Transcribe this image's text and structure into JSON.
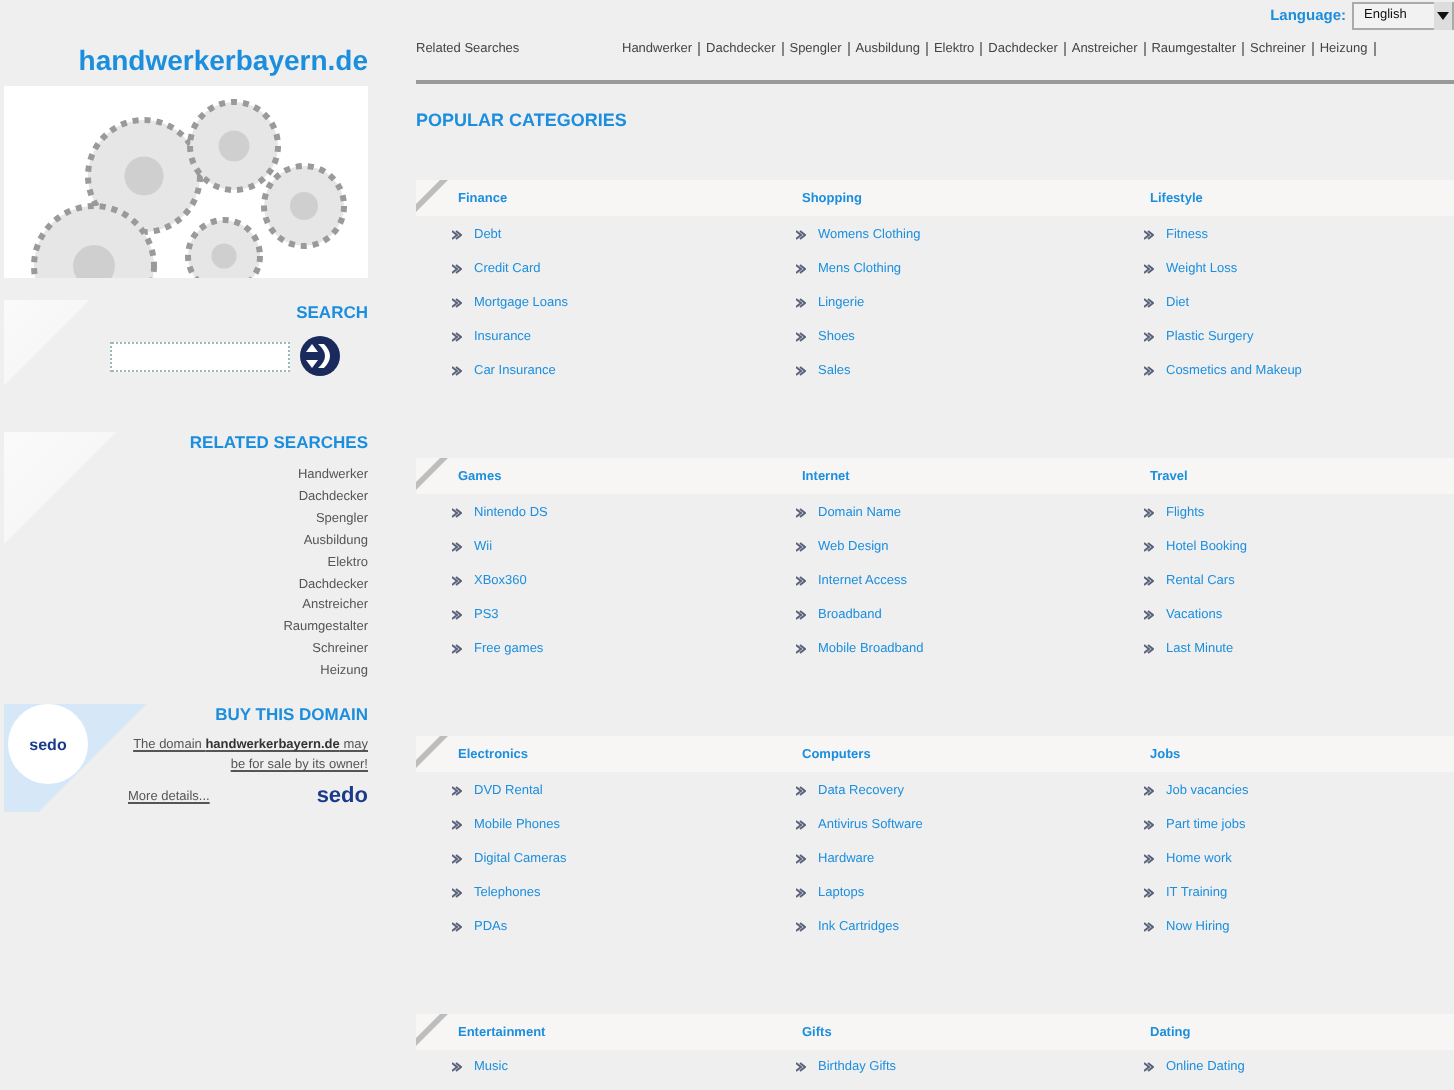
{
  "language": {
    "label": "Language:",
    "value": "English"
  },
  "site_title": "handwerkerbayern.de",
  "top_related": {
    "label": "Related Searches",
    "links": [
      "Handwerker",
      "Dachdecker",
      "Spengler",
      "Ausbildung",
      "Elektro",
      "Dachdecker",
      "Anstreicher",
      "Raumgestalter",
      "Schreiner",
      "Heizung"
    ]
  },
  "search": {
    "heading": "SEARCH"
  },
  "related_searches": {
    "heading": "RELATED SEARCHES",
    "links": [
      "Handwerker",
      "Dachdecker",
      "Spengler",
      "Ausbildung",
      "Elektro",
      "Dachdecker",
      "Anstreicher",
      "Raumgestalter",
      "Schreiner",
      "Heizung"
    ]
  },
  "buy_domain": {
    "heading": "BUY THIS DOMAIN",
    "badge_logo": "sedo",
    "text": "The domain **handwerkerbayern.de** may be for sale by its owner!",
    "more": "More details...",
    "footer_logo": "sedo"
  },
  "popular": {
    "heading": "POPULAR CATEGORIES",
    "groups": [
      [
        {
          "title": "Finance",
          "links": [
            "Debt",
            "Credit Card",
            "Mortgage Loans",
            "Insurance",
            "Car Insurance"
          ]
        },
        {
          "title": "Shopping",
          "links": [
            "Womens Clothing",
            "Mens Clothing",
            "Lingerie",
            "Shoes",
            "Sales"
          ]
        },
        {
          "title": "Lifestyle",
          "links": [
            "Fitness",
            "Weight Loss",
            "Diet",
            "Plastic Surgery",
            "Cosmetics and Makeup"
          ]
        }
      ],
      [
        {
          "title": "Games",
          "links": [
            "Nintendo DS",
            "Wii",
            "XBox360",
            "PS3",
            "Free games"
          ]
        },
        {
          "title": "Internet",
          "links": [
            "Domain Name",
            "Web Design",
            "Internet Access",
            "Broadband",
            "Mobile Broadband"
          ]
        },
        {
          "title": "Travel",
          "links": [
            "Flights",
            "Hotel Booking",
            "Rental Cars",
            "Vacations",
            "Last Minute"
          ]
        }
      ],
      [
        {
          "title": "Electronics",
          "links": [
            "DVD Rental",
            "Mobile Phones",
            "Digital Cameras",
            "Telephones",
            "PDAs"
          ]
        },
        {
          "title": "Computers",
          "links": [
            "Data Recovery",
            "Antivirus Software",
            "Hardware",
            "Laptops",
            "Ink Cartridges"
          ]
        },
        {
          "title": "Jobs",
          "links": [
            "Job vacancies",
            "Part time jobs",
            "Home work",
            "IT Training",
            "Now Hiring"
          ]
        }
      ],
      [
        {
          "title": "Entertainment",
          "links": [
            "Music"
          ]
        },
        {
          "title": "Gifts",
          "links": [
            "Birthday Gifts"
          ]
        },
        {
          "title": "Dating",
          "links": [
            "Online Dating"
          ]
        }
      ]
    ]
  }
}
